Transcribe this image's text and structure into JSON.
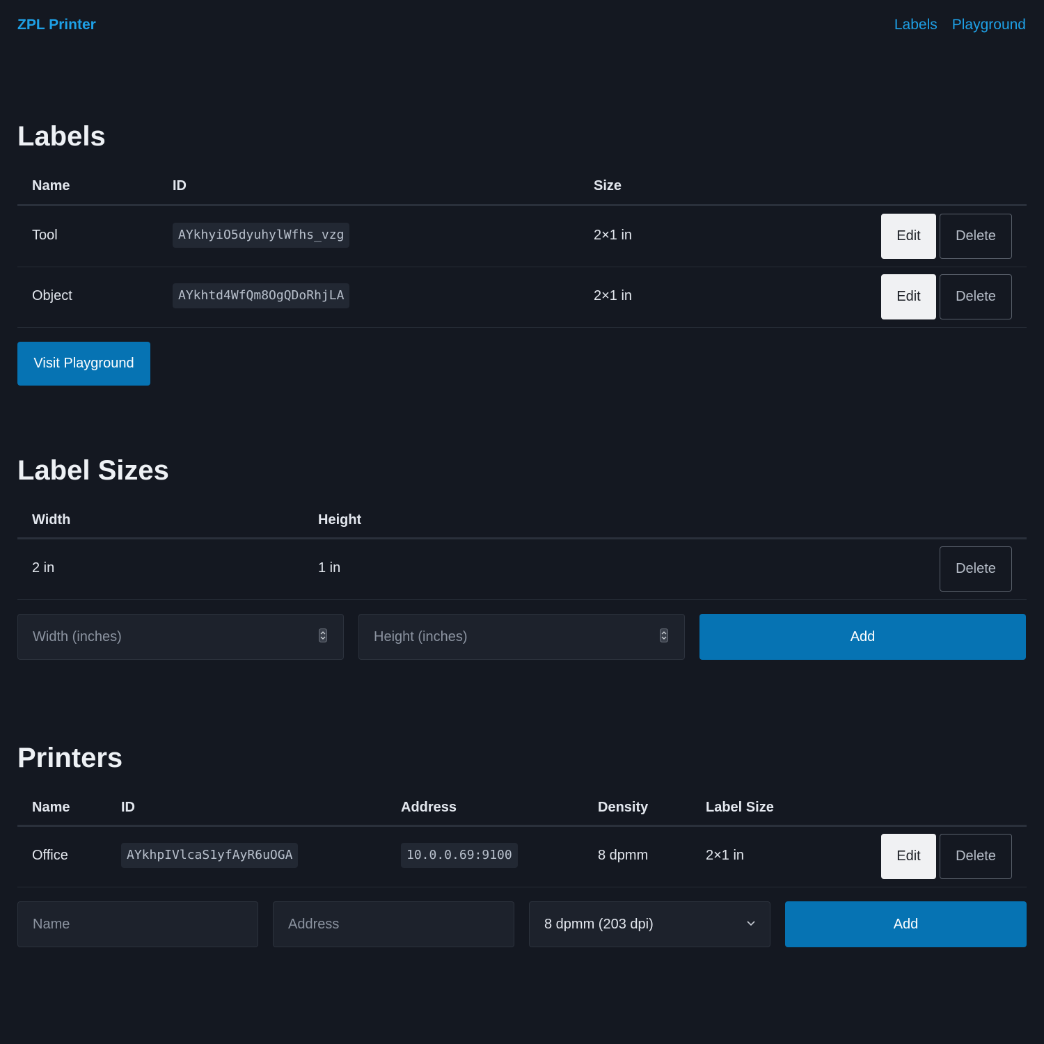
{
  "nav": {
    "brand": "ZPL Printer",
    "links": [
      "Labels",
      "Playground"
    ]
  },
  "labels": {
    "title": "Labels",
    "columns": [
      "Name",
      "ID",
      "Size"
    ],
    "rows": [
      {
        "name": "Tool",
        "id": "AYkhyiO5dyuhylWfhs_vzg",
        "size": "2×1 in"
      },
      {
        "name": "Object",
        "id": "AYkhtd4WfQm8OgQDoRhjLA",
        "size": "2×1 in"
      }
    ],
    "edit_label": "Edit",
    "delete_label": "Delete",
    "visit_button": "Visit Playground"
  },
  "label_sizes": {
    "title": "Label Sizes",
    "columns": [
      "Width",
      "Height"
    ],
    "rows": [
      {
        "width": "2 in",
        "height": "1 in"
      }
    ],
    "delete_label": "Delete",
    "width_placeholder": "Width (inches)",
    "height_placeholder": "Height (inches)",
    "add_label": "Add"
  },
  "printers": {
    "title": "Printers",
    "columns": [
      "Name",
      "ID",
      "Address",
      "Density",
      "Label Size"
    ],
    "rows": [
      {
        "name": "Office",
        "id": "AYkhpIVlcaS1yfAyR6uOGA",
        "address": "10.0.0.69:9100",
        "density": "8 dpmm",
        "label_size": "2×1 in"
      }
    ],
    "edit_label": "Edit",
    "delete_label": "Delete",
    "name_placeholder": "Name",
    "address_placeholder": "Address",
    "density_selected": "8 dpmm (203 dpi)",
    "add_label": "Add"
  },
  "colors": {
    "background": "#141821",
    "link": "#1ea0e6",
    "primary": "#0673b3"
  }
}
